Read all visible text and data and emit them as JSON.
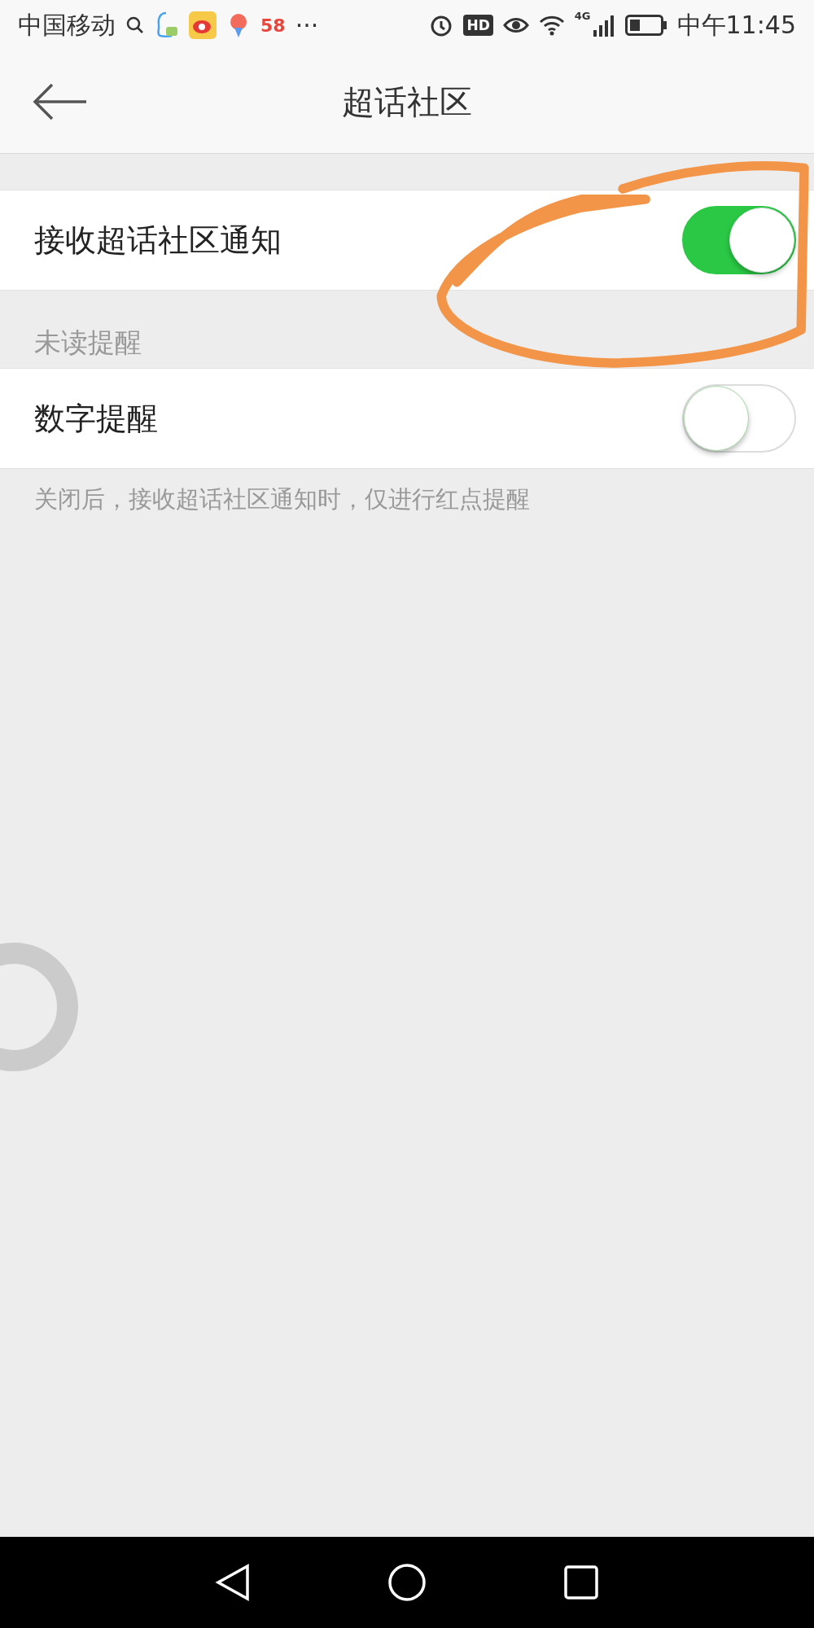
{
  "status_bar": {
    "carrier": "中国移动",
    "more": "···",
    "app_58": "58",
    "hd": "HD",
    "network": "4G",
    "time": "中午11:45"
  },
  "header": {
    "title": "超话社区"
  },
  "items": [
    {
      "kind": "toggle_row",
      "label": "接收超话社区通知",
      "on": true
    },
    {
      "kind": "section_label",
      "label": "未读提醒"
    },
    {
      "kind": "toggle_row",
      "label": "数字提醒",
      "on": false
    },
    {
      "kind": "note",
      "label": "关闭后，接收超话社区通知时，仅进行红点提醒"
    }
  ]
}
